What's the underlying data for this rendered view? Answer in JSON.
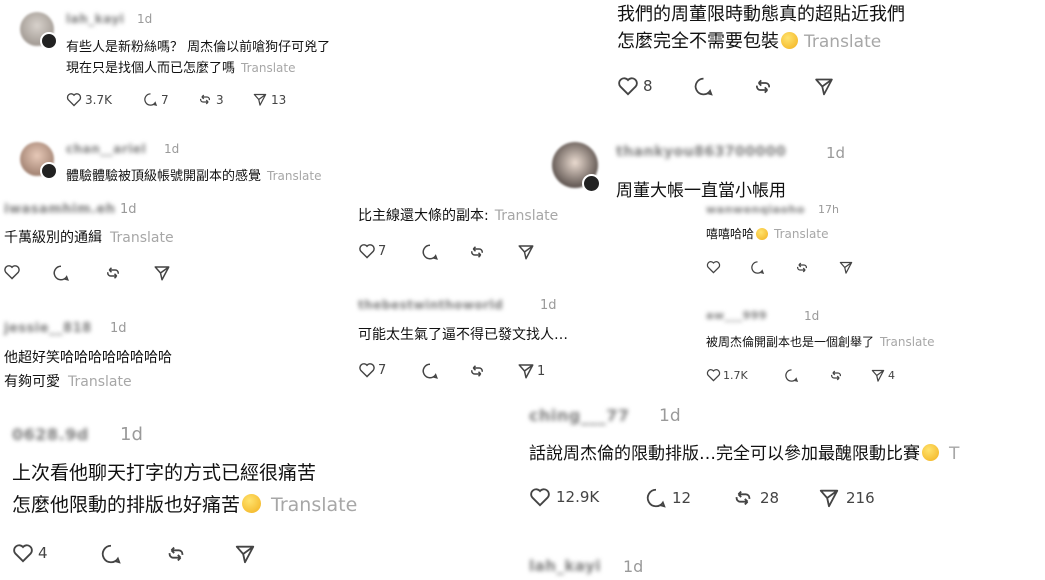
{
  "comments": {
    "c1": {
      "text1": "有些人是新粉絲嗎？ 周杰倫以前嗆狗仔可兇了",
      "text2": "現在只是找個人而已怎麼了嗎",
      "translate": "Translate",
      "time": "1d",
      "user": "lah_kayi",
      "likes": "3.7K",
      "replies": "7",
      "reposts": "3",
      "shares": "13"
    },
    "c2": {
      "text1": "我們的周董限時動態真的超貼近我們",
      "text2": "怎麼完全不需要包裝",
      "translate": "Translate",
      "likes": "8"
    },
    "c3": {
      "user": "chan__ariel",
      "time": "1d",
      "text": "體驗體驗被頂級帳號開副本的感覺",
      "translate": "Translate"
    },
    "c4": {
      "user": "thankyou863700000",
      "time": "1d",
      "text": "周董大帳一直當小帳用"
    },
    "c5": {
      "user": "iwasamhim.eh",
      "time": "1d",
      "text": "千萬級別的通緝",
      "translate": "Translate"
    },
    "c6": {
      "text": "比主線還大條的副本:",
      "translate": "Translate",
      "likes": "7"
    },
    "c7": {
      "user": "wanwenqiaoho",
      "time": "17h",
      "text": "嘻嘻哈哈",
      "translate": "Translate"
    },
    "c8": {
      "user": "jessie__818",
      "time": "1d",
      "text1": "他超好笑哈哈哈哈哈哈哈哈",
      "text2": "有夠可愛",
      "translate": "Translate"
    },
    "c9": {
      "user": "thebestwinthoworld",
      "time": "1d",
      "text": "可能太生氣了逼不得已發文找人…",
      "likes": "7",
      "shares": "1"
    },
    "c10": {
      "user": "aw___999",
      "time": "1d",
      "text": "被周杰倫開副本也是一個創舉了",
      "translate": "Translate",
      "likes": "1.7K",
      "shares": "4"
    },
    "c11": {
      "user": "0628.9d",
      "time": "1d",
      "text1": "上次看他聊天打字的方式已經很痛苦",
      "text2": "怎麼他限動的排版也好痛苦",
      "translate": "Translate",
      "likes": "4"
    },
    "c12": {
      "user": "ching___77",
      "time": "1d",
      "text": "話說周杰倫的限動排版…完全可以參加最醜限動比賽",
      "translate": "T",
      "likes": "12.9K",
      "replies": "12",
      "reposts": "28",
      "shares": "216"
    },
    "c13": {
      "user": "lah_kayi",
      "time": "1d"
    }
  },
  "icons": {
    "like": "heart-icon",
    "reply": "comment-icon",
    "repost": "repost-icon",
    "share": "share-icon",
    "emoji": "grinning-emoji-icon"
  }
}
